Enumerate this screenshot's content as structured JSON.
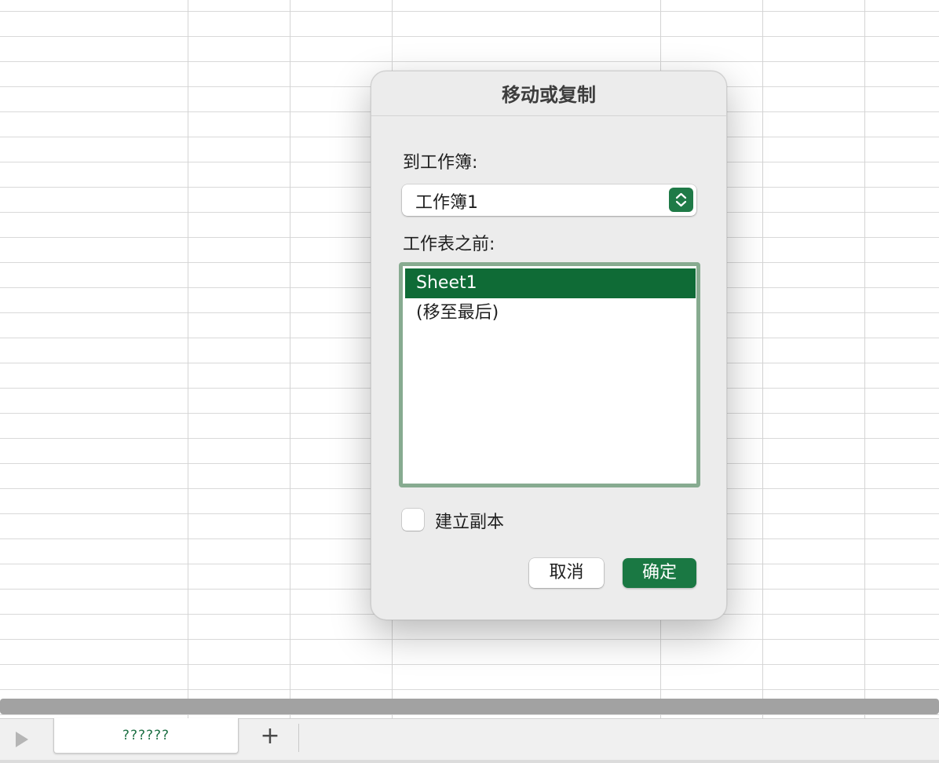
{
  "dialog": {
    "title": "移动或复制",
    "workbook_label": "到工作簿:",
    "workbook_value": "工作簿1",
    "before_sheet_label": "工作表之前:",
    "sheets": [
      {
        "label": "Sheet1",
        "selected": true
      },
      {
        "label": "(移至最后)",
        "selected": false
      }
    ],
    "copy_checkbox_label": "建立副本",
    "copy_checked": false,
    "cancel_label": "取消",
    "ok_label": "确定"
  },
  "tabbar": {
    "active_tab_label": "??????",
    "add_sheet_label": "+"
  },
  "icons": {
    "nav": "play-triangle-icon",
    "stepper": "chevron-up-down-icon"
  },
  "colors": {
    "accent": "#1a7843",
    "selection": "#0f6b36",
    "focus_ring": "#87ab90",
    "tab_text": "#1e7145"
  }
}
